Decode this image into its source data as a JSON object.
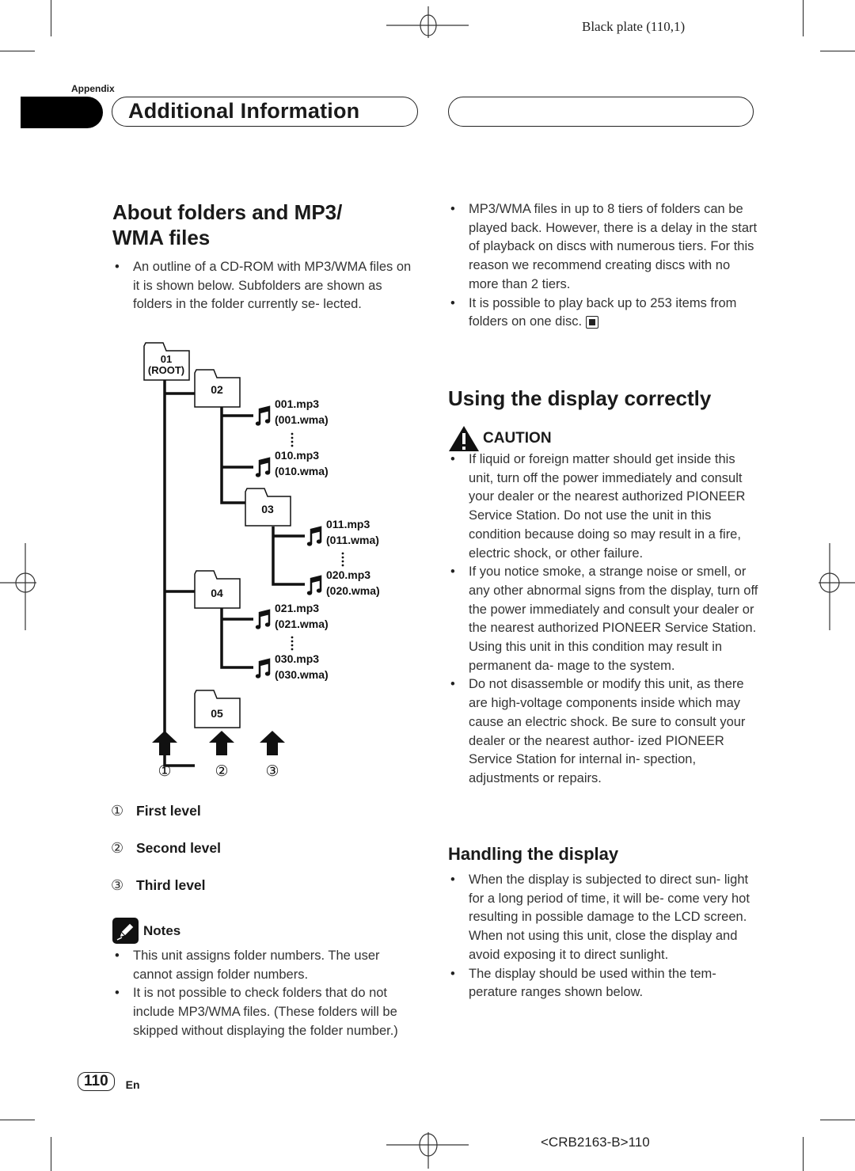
{
  "plate": "Black plate (110,1)",
  "section_label": "Appendix",
  "header_title": "Additional Information",
  "left": {
    "title_line1": "About folders and MP3/",
    "title_line2": "WMA files",
    "intro_bullets": [
      "An outline of a CD-ROM with MP3/WMA files on it is shown below. Subfolders are shown as folders in the folder currently se- lected."
    ],
    "diagram": {
      "folders": [
        {
          "id": "01",
          "sub": "(ROOT)"
        },
        {
          "id": "02"
        },
        {
          "id": "03"
        },
        {
          "id": "04"
        },
        {
          "id": "05"
        }
      ],
      "files": [
        {
          "mp3": "001.mp3",
          "wma": "(001.wma)"
        },
        {
          "mp3": "010.mp3",
          "wma": "(010.wma)"
        },
        {
          "mp3": "011.mp3",
          "wma": "(011.wma)"
        },
        {
          "mp3": "020.mp3",
          "wma": "(020.wma)"
        },
        {
          "mp3": "021.mp3",
          "wma": "(021.wma)"
        },
        {
          "mp3": "030.mp3",
          "wma": "(030.wma)"
        }
      ],
      "level_markers": [
        "①",
        "②",
        "③"
      ]
    },
    "levels": [
      {
        "num": "①",
        "label": "First level"
      },
      {
        "num": "②",
        "label": "Second level"
      },
      {
        "num": "③",
        "label": "Third level"
      }
    ],
    "notes_label": "Notes",
    "notes": [
      "This unit assigns folder numbers. The user cannot assign folder numbers.",
      "It is not possible to check folders that do not include MP3/WMA files. (These folders will be skipped without displaying the folder number.)"
    ]
  },
  "right": {
    "top_bullets": [
      "MP3/WMA files in up to 8 tiers of folders can be played back. However, there is a delay in the start of playback on discs with numerous tiers. For this reason we recommend creating discs with no more than 2 tiers.",
      "It is possible to play back up to 253 items from folders on one disc."
    ],
    "display_title": "Using the display correctly",
    "caution_label": "CAUTION",
    "caution_bullets": [
      "If liquid or foreign matter should get inside this unit, turn off the power immediately and consult your dealer or the nearest authorized PIONEER Service Station. Do not use the unit in this condition because doing so may result in a fire, electric shock, or other failure.",
      "If you notice smoke, a strange noise or smell, or any other abnormal signs from the display, turn off the power immediately and consult your dealer or the nearest authorized PIONEER Service Station. Using this unit in this condition may result in permanent da- mage to the system.",
      "Do not disassemble or modify this unit, as there are high-voltage components inside which may cause an electric shock. Be sure to consult your dealer or the nearest author- ized PIONEER Service Station for internal in- spection, adjustments or repairs."
    ],
    "handling_title": "Handling the display",
    "handling_bullets": [
      "When the display is subjected to direct sun- light for a long period of time, it will be- come very hot resulting in possible damage to the LCD screen. When not using this unit, close the display and avoid exposing it to direct sunlight.",
      "The display should be used within the tem- perature ranges shown below."
    ]
  },
  "footer": {
    "page_number": "110",
    "language": "En",
    "code": "<CRB2163-B>110"
  }
}
